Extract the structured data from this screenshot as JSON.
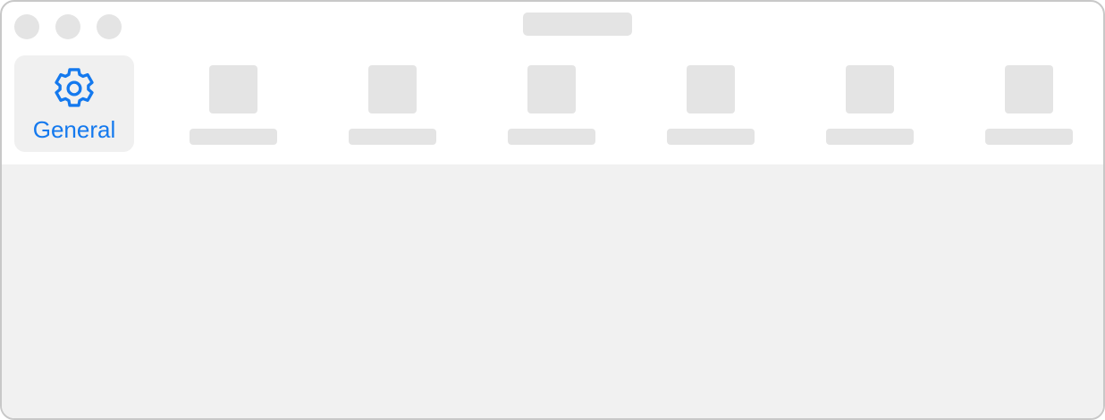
{
  "window": {
    "title": "",
    "controls": [
      "close",
      "minimize",
      "zoom"
    ]
  },
  "toolbar": {
    "tabs": [
      {
        "label": "General",
        "icon": "gear-icon",
        "selected": true
      },
      {
        "label": "",
        "icon": "placeholder-icon",
        "selected": false
      },
      {
        "label": "",
        "icon": "placeholder-icon",
        "selected": false
      },
      {
        "label": "",
        "icon": "placeholder-icon",
        "selected": false
      },
      {
        "label": "",
        "icon": "placeholder-icon",
        "selected": false
      },
      {
        "label": "",
        "icon": "placeholder-icon",
        "selected": false
      },
      {
        "label": "",
        "icon": "placeholder-icon",
        "selected": false
      }
    ]
  },
  "colors": {
    "accent": "#1479ee",
    "placeholder": "#e4e4e4",
    "content_background": "#f1f1f1",
    "selected_tab_background": "#f0f0f0",
    "window_border": "#c8c8c8"
  }
}
